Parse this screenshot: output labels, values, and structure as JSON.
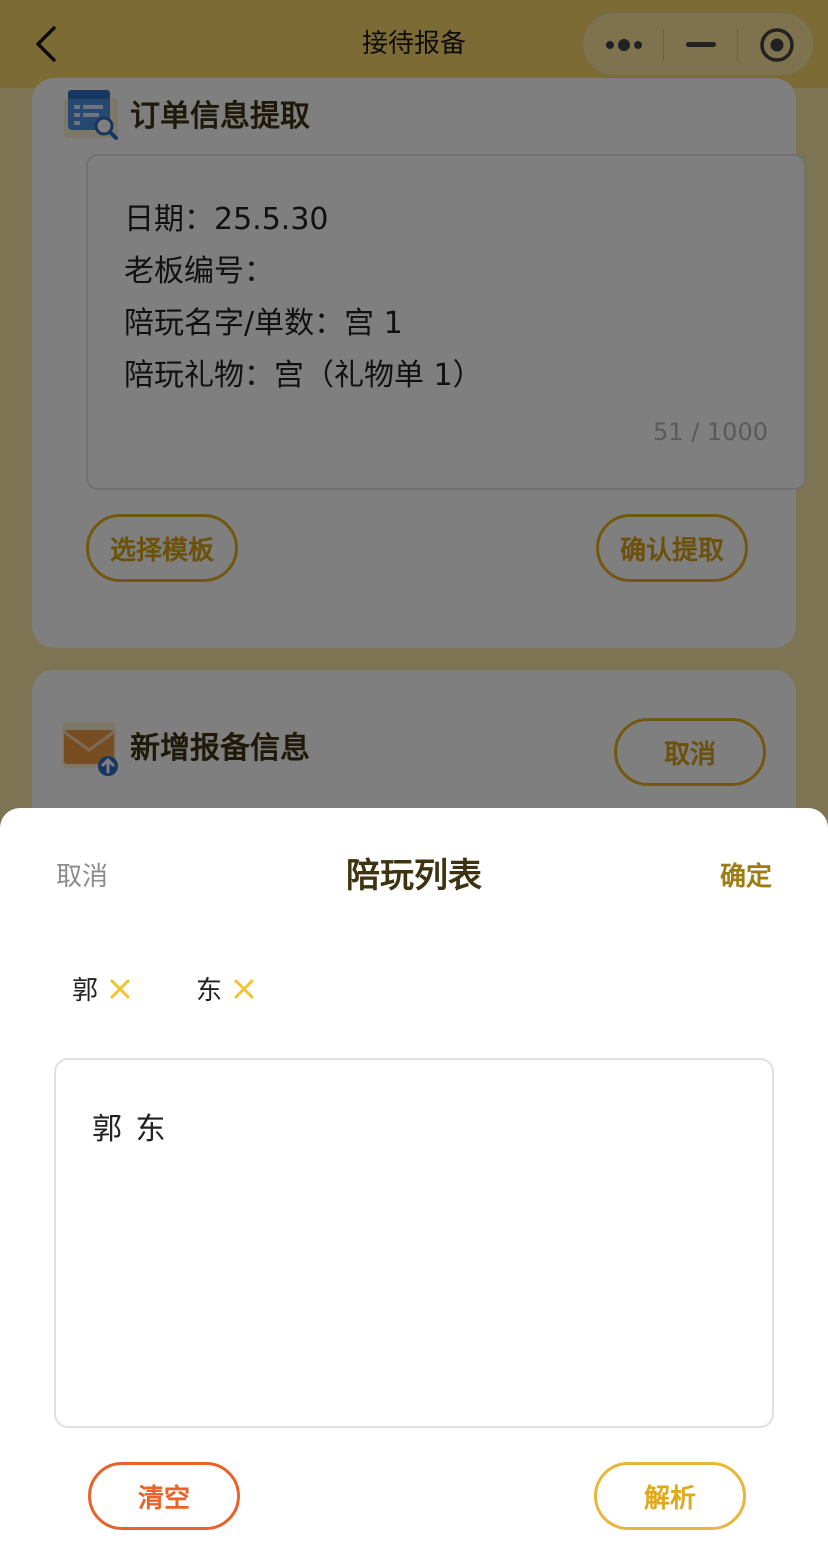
{
  "navbar": {
    "title": "接待报备"
  },
  "order_section": {
    "title": "订单信息提取",
    "content": "日期：25.5.30\n老板编号：\n陪玩名字/单数：宫 1\n陪玩礼物：宫（礼物单 1）",
    "count": "51 / 1000",
    "select_template_label": "选择模板",
    "confirm_extract_label": "确认提取"
  },
  "report_section": {
    "title": "新增报备信息",
    "cancel_label": "取消"
  },
  "sheet": {
    "cancel_label": "取消",
    "title": "陪玩列表",
    "confirm_label": "确定",
    "tags": [
      "郭",
      "东"
    ],
    "input_value": "郭 东",
    "clear_label": "清空",
    "parse_label": "解析"
  },
  "colors": {
    "navbar": "#fad66b",
    "accent_gold": "#e5b020",
    "clear_red": "#e8622a",
    "title_dark": "#3d3310"
  }
}
